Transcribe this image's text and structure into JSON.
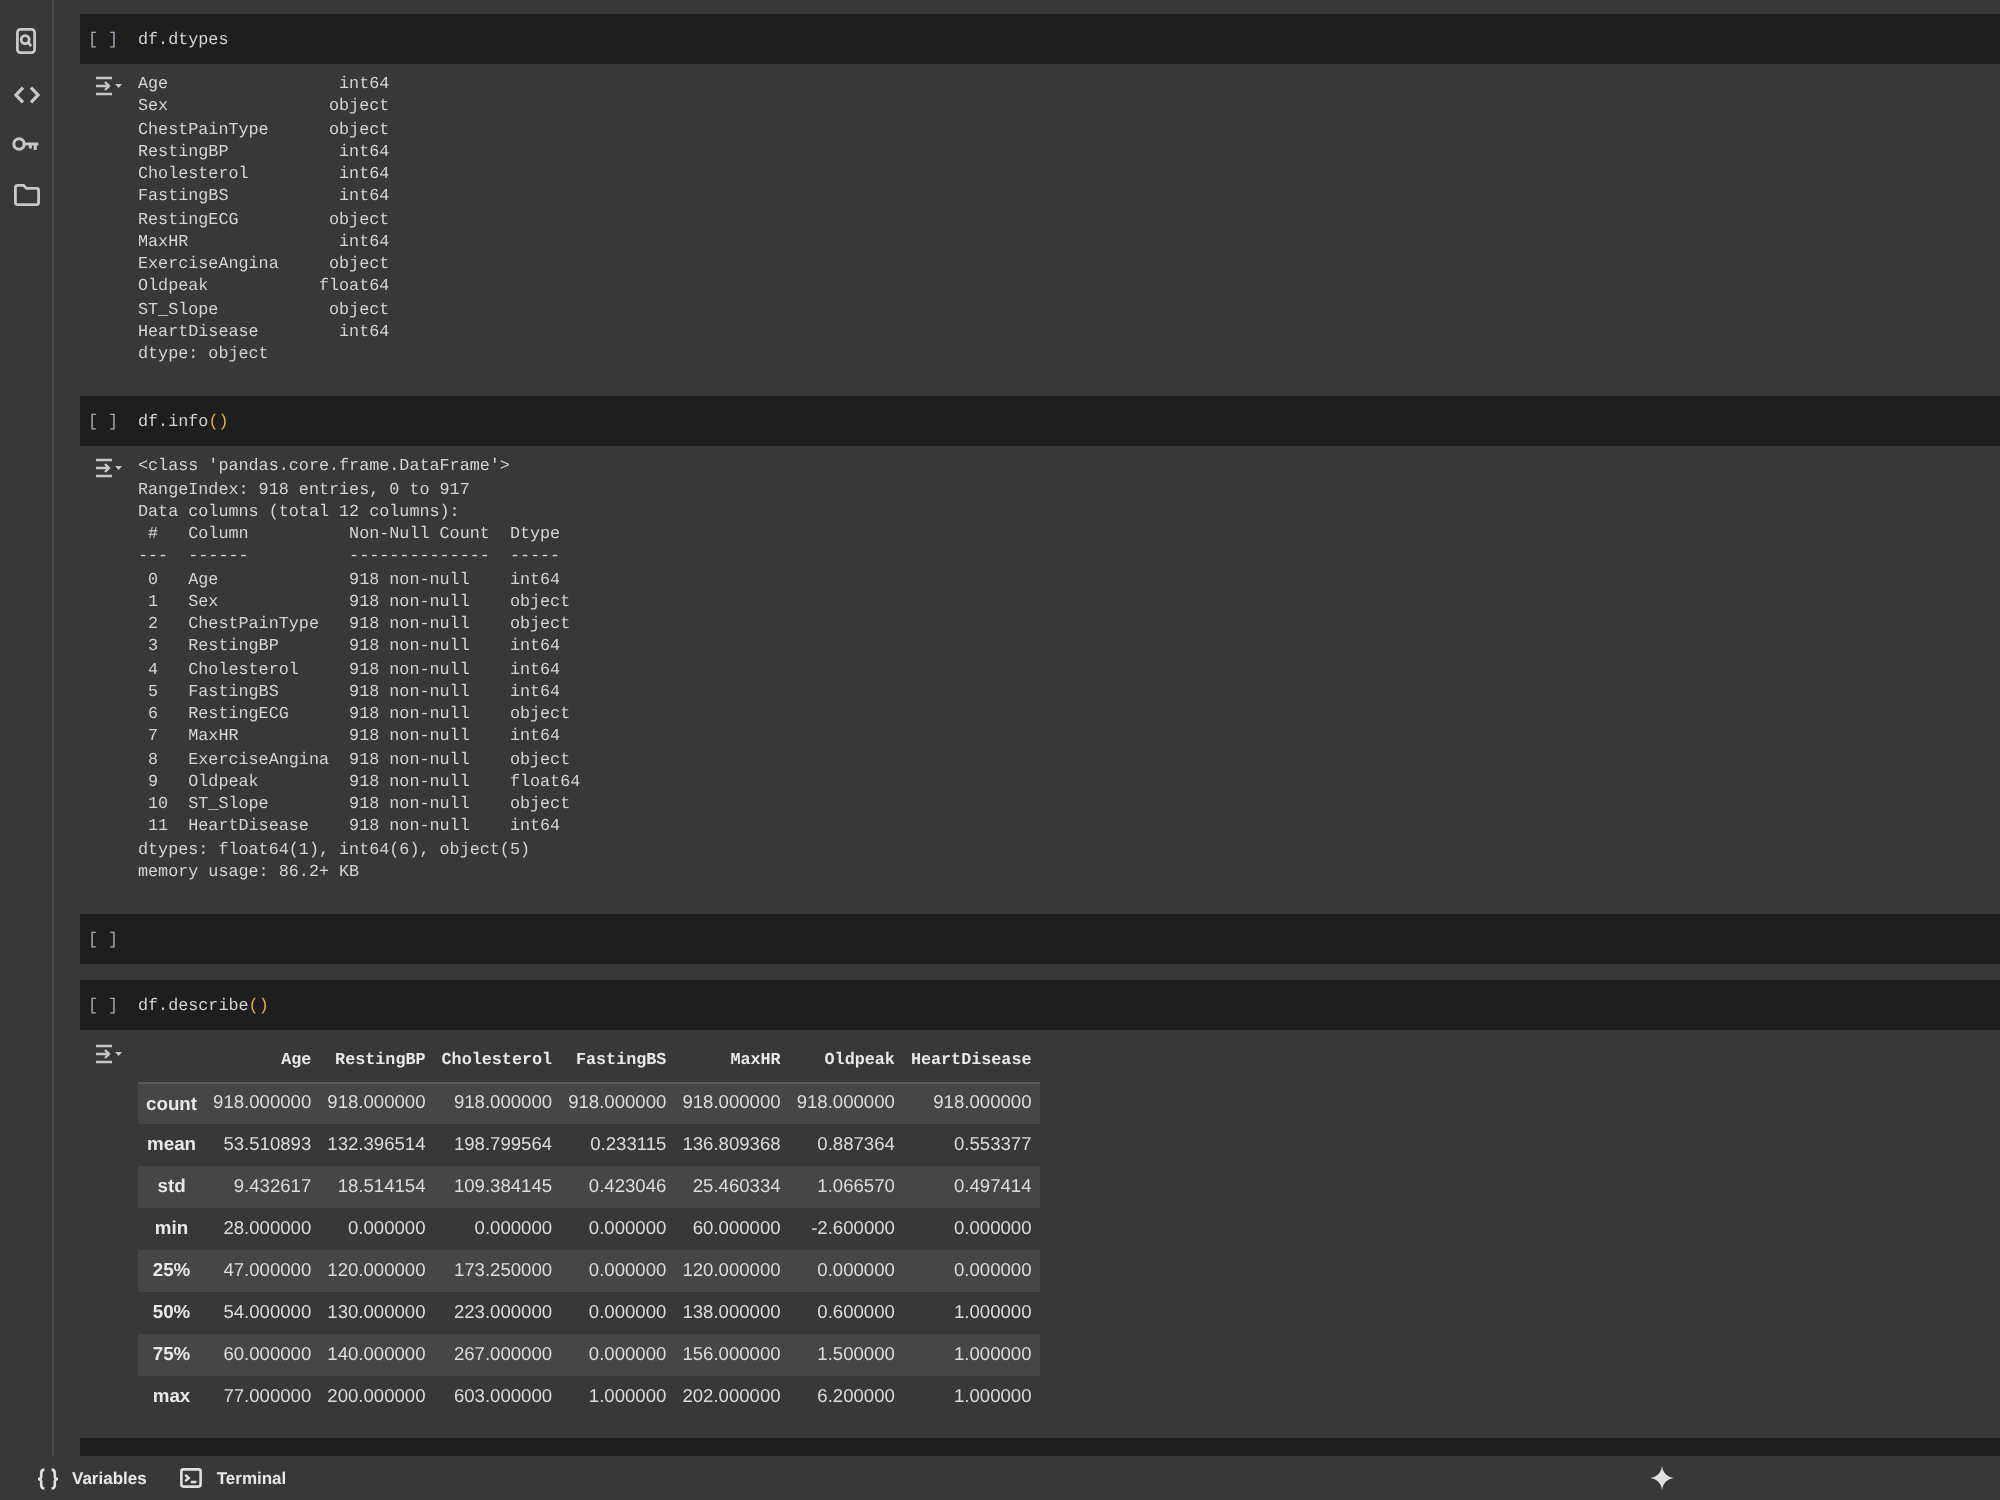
{
  "cells": [
    {
      "run_label": "[ ]",
      "code": [
        {
          "kind": "name",
          "text": "df.dtypes"
        }
      ],
      "output": {
        "kind": "text",
        "lines": [
          "Age                 int64",
          "Sex                object",
          "ChestPainType      object",
          "RestingBP           int64",
          "Cholesterol         int64",
          "FastingBS           int64",
          "RestingECG         object",
          "MaxHR               int64",
          "ExerciseAngina     object",
          "Oldpeak           float64",
          "ST_Slope           object",
          "HeartDisease        int64",
          "dtype: object"
        ]
      }
    },
    {
      "run_label": "[ ]",
      "code": [
        {
          "kind": "name",
          "text": "df.info"
        },
        {
          "kind": "paren",
          "text": "()"
        }
      ],
      "output": {
        "kind": "text",
        "lines": [
          "<class 'pandas.core.frame.DataFrame'>",
          "RangeIndex: 918 entries, 0 to 917",
          "Data columns (total 12 columns):",
          " #   Column          Non-Null Count  Dtype",
          "---  ------          --------------  -----",
          " 0   Age             918 non-null    int64",
          " 1   Sex             918 non-null    object",
          " 2   ChestPainType   918 non-null    object",
          " 3   RestingBP       918 non-null    int64",
          " 4   Cholesterol     918 non-null    int64",
          " 5   FastingBS       918 non-null    int64",
          " 6   RestingECG      918 non-null    object",
          " 7   MaxHR           918 non-null    int64",
          " 8   ExerciseAngina  918 non-null    object",
          " 9   Oldpeak         918 non-null    float64",
          " 10  ST_Slope        918 non-null    object",
          " 11  HeartDisease    918 non-null    int64",
          "dtypes: float64(1), int64(6), object(5)",
          "memory usage: 86.2+ KB"
        ]
      }
    },
    {
      "run_label": "[ ]"
    },
    {
      "run_label": "[ ]",
      "code": [
        {
          "kind": "name",
          "text": "df.describe"
        },
        {
          "kind": "paren",
          "text": "()"
        }
      ],
      "output": {
        "kind": "table",
        "table": {
          "columns": [
            "Age",
            "RestingBP",
            "Cholesterol",
            "FastingBS",
            "MaxHR",
            "Oldpeak",
            "HeartDisease"
          ],
          "rows": [
            {
              "label": "count",
              "values": [
                "918.000000",
                "918.000000",
                "918.000000",
                "918.000000",
                "918.000000",
                "918.000000",
                "918.000000"
              ]
            },
            {
              "label": "mean",
              "values": [
                "53.510893",
                "132.396514",
                "198.799564",
                "0.233115",
                "136.809368",
                "0.887364",
                "0.553377"
              ]
            },
            {
              "label": "std",
              "values": [
                "9.432617",
                "18.514154",
                "109.384145",
                "0.423046",
                "25.460334",
                "1.066570",
                "0.497414"
              ]
            },
            {
              "label": "min",
              "values": [
                "28.000000",
                "0.000000",
                "0.000000",
                "0.000000",
                "60.000000",
                "-2.600000",
                "0.000000"
              ]
            },
            {
              "label": "25%",
              "values": [
                "47.000000",
                "120.000000",
                "173.250000",
                "0.000000",
                "120.000000",
                "0.000000",
                "0.000000"
              ]
            },
            {
              "label": "50%",
              "values": [
                "54.000000",
                "130.000000",
                "223.000000",
                "0.000000",
                "138.000000",
                "0.600000",
                "1.000000"
              ]
            },
            {
              "label": "75%",
              "values": [
                "60.000000",
                "140.000000",
                "267.000000",
                "0.000000",
                "156.000000",
                "1.500000",
                "1.000000"
              ]
            },
            {
              "label": "max",
              "values": [
                "77.000000",
                "200.000000",
                "603.000000",
                "1.000000",
                "202.000000",
                "6.200000",
                "1.000000"
              ]
            }
          ]
        }
      }
    }
  ],
  "bottom_bar": {
    "items": [
      {
        "kind": "variables",
        "label": "Variables"
      },
      {
        "kind": "terminal",
        "label": "Terminal"
      }
    ]
  }
}
